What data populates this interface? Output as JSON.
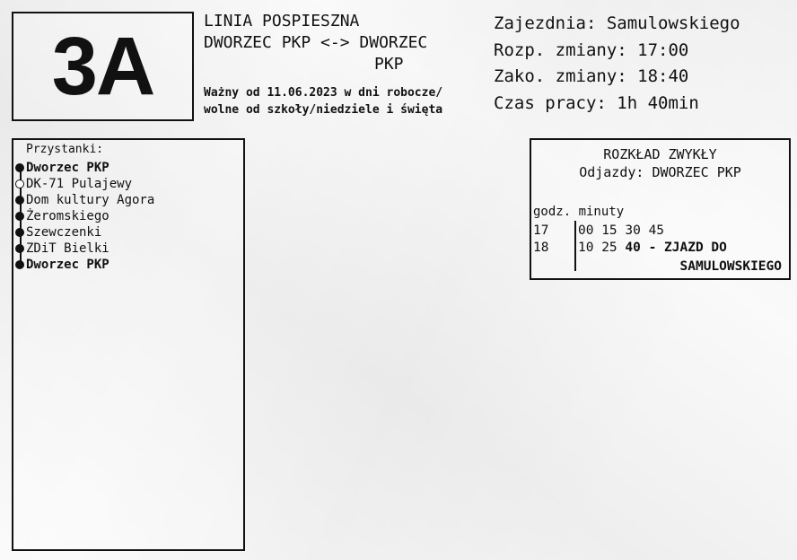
{
  "line": {
    "number": "3A",
    "type": "LINIA POSPIESZNA",
    "route_line1": "DWORZEC PKP <-> DWORZEC",
    "route_line2": "PKP",
    "validity_line1": "Ważny od 11.06.2023 w dni robocze/",
    "validity_line2": "wolne od szkoły/niedziele i święta"
  },
  "shift": {
    "depot": "Zajezdnia: Samulowskiego",
    "start": "Rozp. zmiany: 17:00",
    "end": "Zako. zmiany: 18:40",
    "duration": "Czas pracy: 1h 40min"
  },
  "stops": {
    "heading": "Przystanki:",
    "items": [
      {
        "name": "Dworzec PKP",
        "bold": true,
        "on_request": false
      },
      {
        "name": "DK-71 Pulajewy",
        "bold": false,
        "on_request": true
      },
      {
        "name": "Dom kultury Agora",
        "bold": false,
        "on_request": false
      },
      {
        "name": "Żeromskiego",
        "bold": false,
        "on_request": false
      },
      {
        "name": "Szewczenki",
        "bold": false,
        "on_request": false
      },
      {
        "name": "ZDiT Bielki",
        "bold": false,
        "on_request": false
      },
      {
        "name": "Dworzec PKP",
        "bold": true,
        "on_request": false
      }
    ]
  },
  "timetable": {
    "title": "ROZKŁAD ZWYKŁY",
    "direction": "Odjazdy: DWORZEC PKP",
    "header": "godz. minuty",
    "rows": [
      {
        "hour": "17",
        "minutes": "00 15 30 45",
        "note": ""
      },
      {
        "hour": "18",
        "minutes": "10 25 ",
        "note": "40 - ZJAZD DO"
      }
    ],
    "note_line2": "SAMULOWSKIEGO"
  }
}
